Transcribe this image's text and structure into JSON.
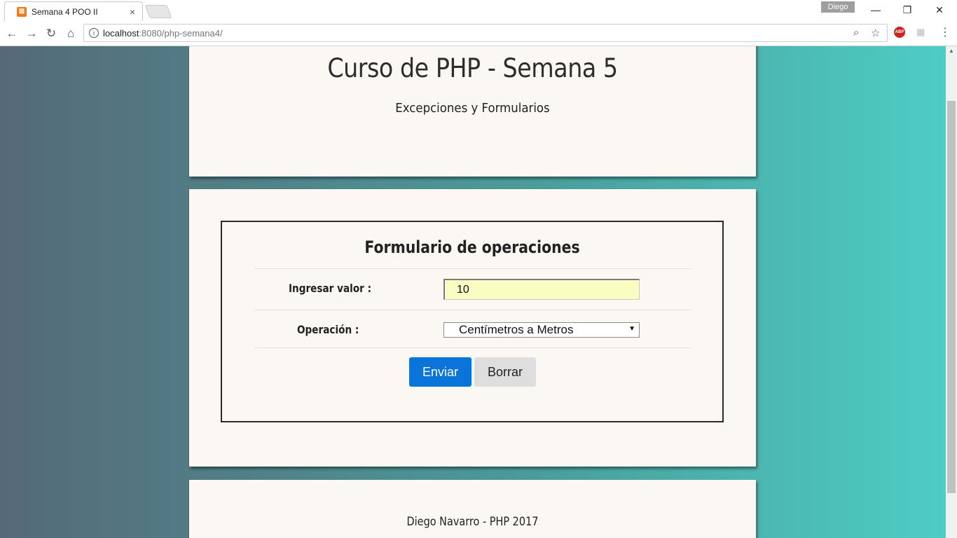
{
  "browser": {
    "tab_title": "Semana 4 POO II",
    "tab_favicon": "xampp-icon",
    "close_glyph": "×",
    "profile_name": "Diego",
    "url_host": "localhost",
    "url_path": ":8080/php-semana4/",
    "window_controls": {
      "minimize": "—",
      "restore": "❐",
      "close": "✕"
    },
    "nav": {
      "back": "←",
      "forward": "→",
      "reload": "↻",
      "home": "⌂"
    },
    "extension_label": "ABP"
  },
  "header": {
    "title": "Curso de PHP - Semana 5",
    "subtitle": "Excepciones y Formularios"
  },
  "form": {
    "title": "Formulario de operaciones",
    "value_label": "Ingresar valor :",
    "value": "10",
    "operation_label": "Operación :",
    "operation_selected": "Centímetros a Metros",
    "send_label": "Enviar",
    "clear_label": "Borrar"
  },
  "footer": {
    "text": "Diego Navarro - PHP 2017"
  },
  "colors": {
    "send_button": "#0a74da",
    "input_background": "#fafdc2",
    "card_background": "#fbf7f2"
  }
}
